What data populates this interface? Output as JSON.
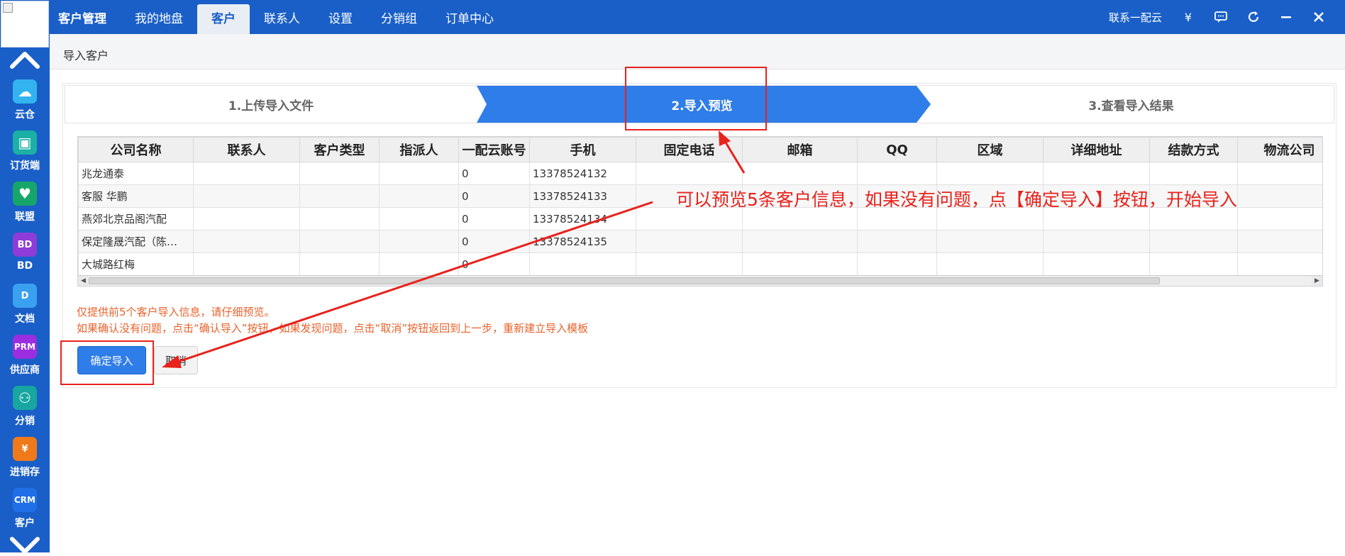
{
  "rail": {
    "items": [
      {
        "label": "云仓",
        "icon": "cloud-icon",
        "color": "#33b3f0",
        "glyph": "☁"
      },
      {
        "label": "订货端",
        "icon": "order-terminal-icon",
        "color": "#1ab0a6",
        "glyph": "▣"
      },
      {
        "label": "联盟",
        "icon": "alliance-heart-icon",
        "color": "#17a66a",
        "glyph": "♥"
      },
      {
        "label": "BD",
        "icon": "bd-icon",
        "color": "#8e3bd9",
        "glyph": "BD"
      },
      {
        "label": "文档",
        "icon": "document-icon",
        "color": "#3aa0f0",
        "glyph": "D"
      },
      {
        "label": "供应商",
        "icon": "prm-icon",
        "color": "#9b2ee0",
        "glyph": "PRM"
      },
      {
        "label": "分销",
        "icon": "distribution-icon",
        "color": "#17a6a0",
        "glyph": "⚇"
      },
      {
        "label": "进销存",
        "icon": "inventory-yen-icon",
        "color": "#f07a1a",
        "glyph": "¥"
      },
      {
        "label": "客户",
        "icon": "crm-icon",
        "color": "#1f6fe8",
        "glyph": "CRM"
      }
    ]
  },
  "topbar": {
    "brand": "客户管理",
    "nav": [
      {
        "label": "我的地盘",
        "active": false
      },
      {
        "label": "客户",
        "active": true
      },
      {
        "label": "联系人",
        "active": false
      },
      {
        "label": "设置",
        "active": false
      },
      {
        "label": "分销组",
        "active": false
      },
      {
        "label": "订单中心",
        "active": false
      }
    ],
    "contact_link": "联系一配云",
    "icons": [
      "yen-icon",
      "chat-icon",
      "refresh-icon",
      "minimize-icon",
      "close-icon"
    ]
  },
  "breadcrumb": "导入客户",
  "steps": [
    {
      "label": "1.上传导入文件",
      "active": false
    },
    {
      "label": "2.导入预览",
      "active": true
    },
    {
      "label": "3.查看导入结果",
      "active": false
    }
  ],
  "table": {
    "columns": [
      "公司名称",
      "联系人",
      "客户类型",
      "指派人",
      "一配云账号",
      "手机",
      "固定电话",
      "邮箱",
      "QQ",
      "区域",
      "详细地址",
      "结款方式",
      "物流公司"
    ],
    "rows": [
      [
        "兆龙通泰",
        "",
        "",
        "",
        "0",
        "13378524132",
        "",
        "",
        "",
        "",
        "",
        "",
        ""
      ],
      [
        "客服 华鹏",
        "",
        "",
        "",
        "0",
        "13378524133",
        "",
        "",
        "",
        "",
        "",
        "",
        ""
      ],
      [
        "燕郊北京品阁汽配",
        "",
        "",
        "",
        "0",
        "13378524134",
        "",
        "",
        "",
        "",
        "",
        "",
        ""
      ],
      [
        "保定隆晟汽配（陈…",
        "",
        "",
        "",
        "0",
        "13378524135",
        "",
        "",
        "",
        "",
        "",
        "",
        ""
      ],
      [
        "大城路红梅",
        "",
        "",
        "",
        "0",
        "",
        "",
        "",
        "",
        "",
        "",
        "",
        ""
      ]
    ]
  },
  "notes": {
    "line1": "仅提供前5个客户导入信息，请仔细预览。",
    "line2": "如果确认没有问题，点击“确认导入”按钮，如果发现问题，点击“取消”按钮返回到上一步，重新建立导入模板"
  },
  "buttons": {
    "confirm": "确定导入",
    "cancel": "取消"
  },
  "annotation": {
    "text": "可以预览5条客户信息，如果没有问题，点【确定导入】按钮，开始导入"
  },
  "colors": {
    "primary": "#1a5fc8",
    "step_active": "#2f7de8",
    "annotation_red": "#e8221c",
    "note_orange": "#e8622c"
  }
}
